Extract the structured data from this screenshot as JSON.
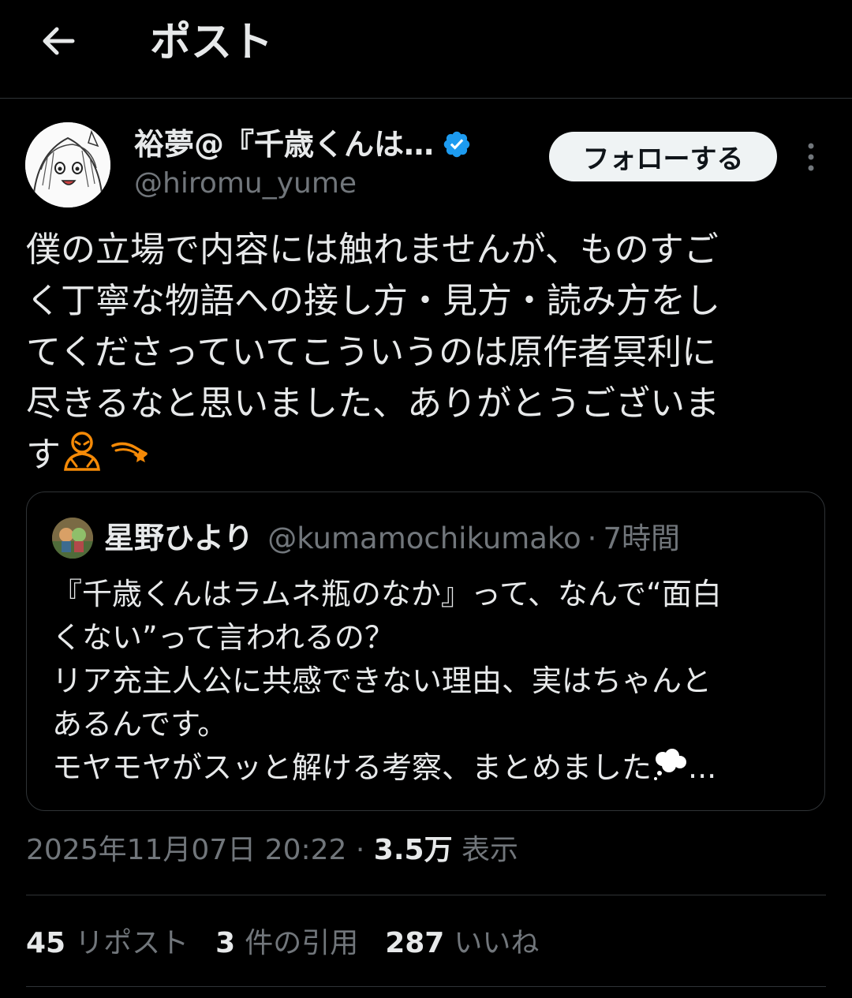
{
  "header": {
    "back_icon": "arrow-left-icon",
    "title": "ポスト"
  },
  "author": {
    "display_name": "裕夢@『千歳くんは…",
    "handle": "@hiromu_yume",
    "verified_icon": "verified-badge-icon",
    "verified_color": "#1d9bf0",
    "follow_label": "フォローする",
    "more_icon": "more-vertical-icon"
  },
  "tweet": {
    "text": "僕の立場で内容には触れませんが、ものすご\nく丁寧な物語への接し方・見方・読み方をし\nてくださっていてこういうのは原作者冥利に\n尽きるなと思いました、ありがとうございま\nす",
    "emojis": [
      "bowing-person-emoji",
      "dizzy-emoji"
    ]
  },
  "quoted": {
    "name": "星野ひより",
    "handle": "@kumamochikumako",
    "separator": "·",
    "time": "7時間",
    "text": "『千歳くんはラムネ瓶のなか』って、なんで“面白\nくない”って言われるの？\nリア充主人公に共感できない理由、実はちゃんと\nあるんです。\nモヤモヤがスッと解ける考察、まとめました",
    "trailing_emoji": "thought-balloon-emoji",
    "ellipsis": "..."
  },
  "meta": {
    "timestamp": "2025年11月07日 20:22",
    "separator": "·",
    "views_count": "3.5万",
    "views_label": "表示"
  },
  "stats": {
    "reposts_count": "45",
    "reposts_label": "リポスト",
    "quotes_count": "3",
    "quotes_label": "件の引用",
    "likes_count": "287",
    "likes_label": "いいね"
  }
}
